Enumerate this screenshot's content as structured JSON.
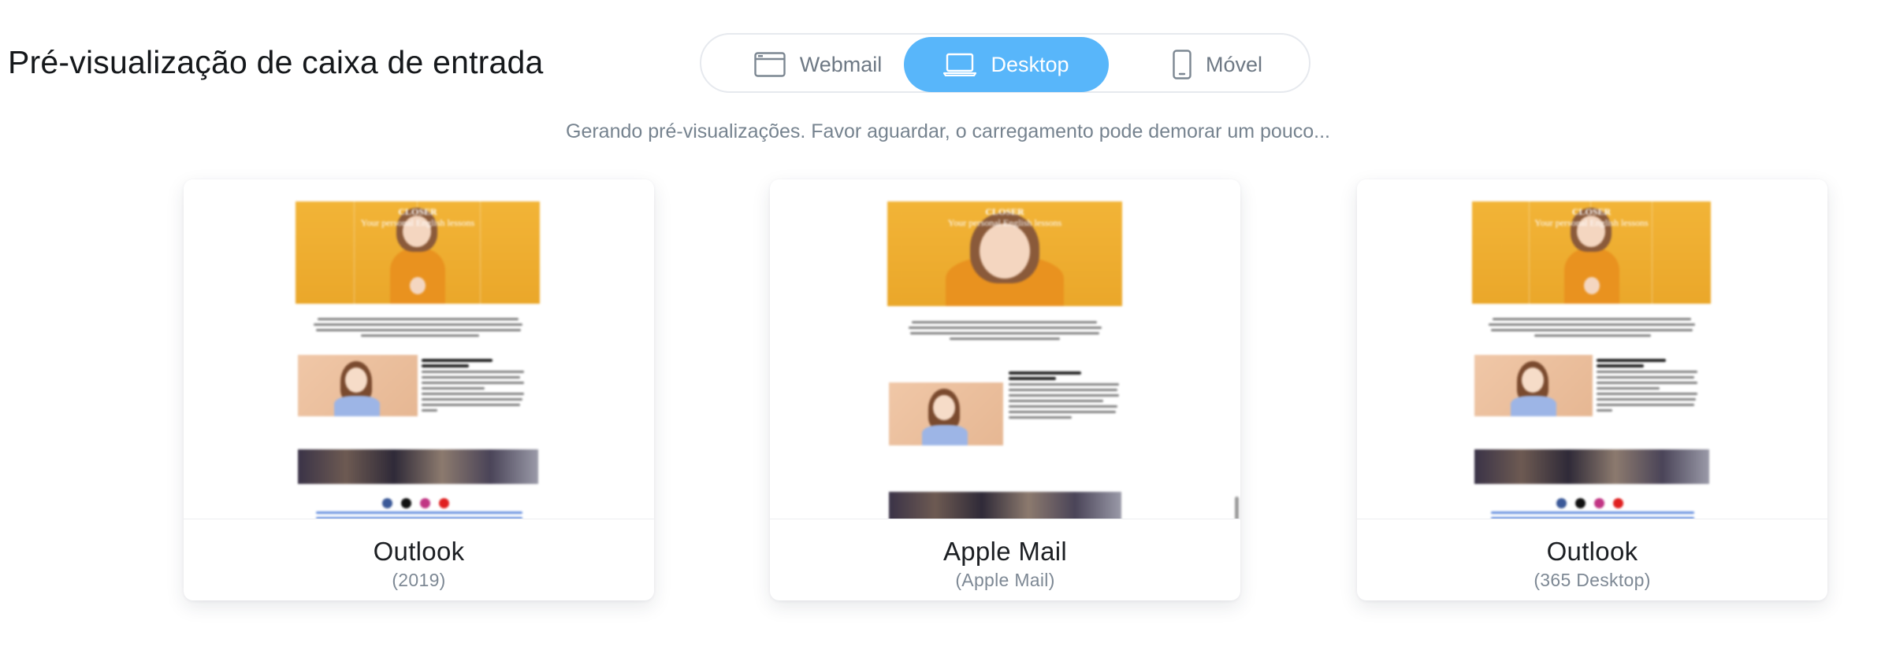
{
  "header": {
    "title": "Pré-visualização de caixa de entrada"
  },
  "toggle": {
    "options": [
      {
        "label": "Webmail",
        "icon": "browser-window-icon",
        "selected": false
      },
      {
        "label": "Desktop",
        "icon": "laptop-icon",
        "selected": true
      },
      {
        "label": "Móvel",
        "icon": "smartphone-icon",
        "selected": false
      }
    ]
  },
  "status": "Gerando pré-visualizações. Favor aguardar, o carregamento pode demorar um pouco...",
  "previews": [
    {
      "client": "Outlook",
      "version": "(2019)"
    },
    {
      "client": "Apple Mail",
      "version": "(Apple Mail)"
    },
    {
      "client": "Outlook",
      "version": "(365 Desktop)"
    }
  ],
  "email": {
    "hero_title": "CLOSER",
    "hero_subtitle": "Your personal English lessons"
  },
  "colors": {
    "accent": "#58b6fa",
    "hero_yellow": "#f2b437",
    "muted_text": "#76838f"
  }
}
